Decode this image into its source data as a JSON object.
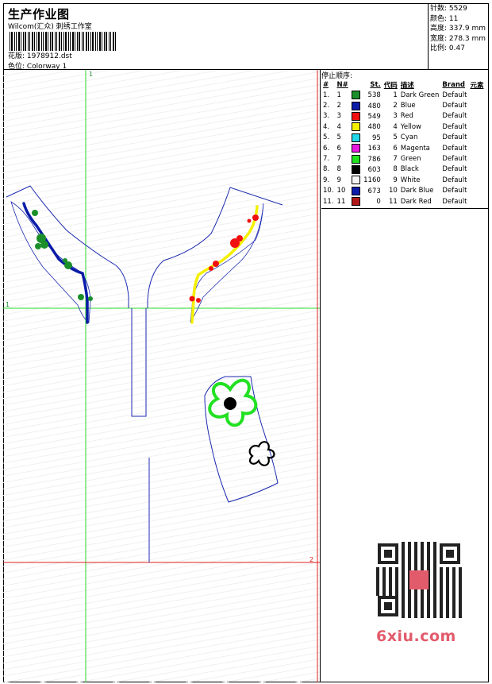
{
  "header": {
    "title": "生产作业图",
    "company": "Wilcom(汇众) 刺绣工作室",
    "design_label": "花版: 1978912.dst",
    "colorway_label": "色位: Colorway 1"
  },
  "stats": {
    "stitches": "针数: 5529",
    "colors": "颜色: 11",
    "height": "高度: 337.9 mm",
    "width": "宽度: 278.3 mm",
    "scale": "比例: 0.47"
  },
  "guides": {
    "label_top": "1",
    "label_left": "1",
    "label_right": "2"
  },
  "legend": {
    "title": "停止顺序:",
    "columns": [
      "#",
      "N#",
      "St.",
      "代码",
      "描述",
      "Brand",
      "元素"
    ],
    "rows": [
      {
        "idx": "1.",
        "n": "1",
        "color": "#1a8f2a",
        "st": "538",
        "code": "1",
        "desc": "Dark Green",
        "brand": "Default"
      },
      {
        "idx": "2.",
        "n": "2",
        "color": "#0a1ca8",
        "st": "480",
        "code": "2",
        "desc": "Blue",
        "brand": "Default"
      },
      {
        "idx": "3.",
        "n": "3",
        "color": "#f01010",
        "st": "549",
        "code": "3",
        "desc": "Red",
        "brand": "Default"
      },
      {
        "idx": "4.",
        "n": "4",
        "color": "#f5f000",
        "st": "480",
        "code": "4",
        "desc": "Yellow",
        "brand": "Default"
      },
      {
        "idx": "5.",
        "n": "5",
        "color": "#20d8e8",
        "st": "95",
        "code": "5",
        "desc": "Cyan",
        "brand": "Default"
      },
      {
        "idx": "6.",
        "n": "6",
        "color": "#e818e0",
        "st": "163",
        "code": "6",
        "desc": "Magenta",
        "brand": "Default"
      },
      {
        "idx": "7.",
        "n": "7",
        "color": "#22e022",
        "st": "786",
        "code": "7",
        "desc": "Green",
        "brand": "Default"
      },
      {
        "idx": "8.",
        "n": "8",
        "color": "#000000",
        "st": "603",
        "code": "8",
        "desc": "Black",
        "brand": "Default"
      },
      {
        "idx": "9.",
        "n": "9",
        "color": "#f4f4f4",
        "st": "1160",
        "code": "9",
        "desc": "White",
        "brand": "Default"
      },
      {
        "idx": "10.",
        "n": "10",
        "color": "#0a1ca8",
        "st": "673",
        "code": "10",
        "desc": "Dark Blue",
        "brand": "Default"
      },
      {
        "idx": "11.",
        "n": "11",
        "color": "#b01818",
        "st": "0",
        "code": "11",
        "desc": "Dark Red",
        "brand": "Default"
      }
    ]
  },
  "watermark": {
    "site": "6xiu.com",
    "brand_color": "#e25b6b"
  }
}
